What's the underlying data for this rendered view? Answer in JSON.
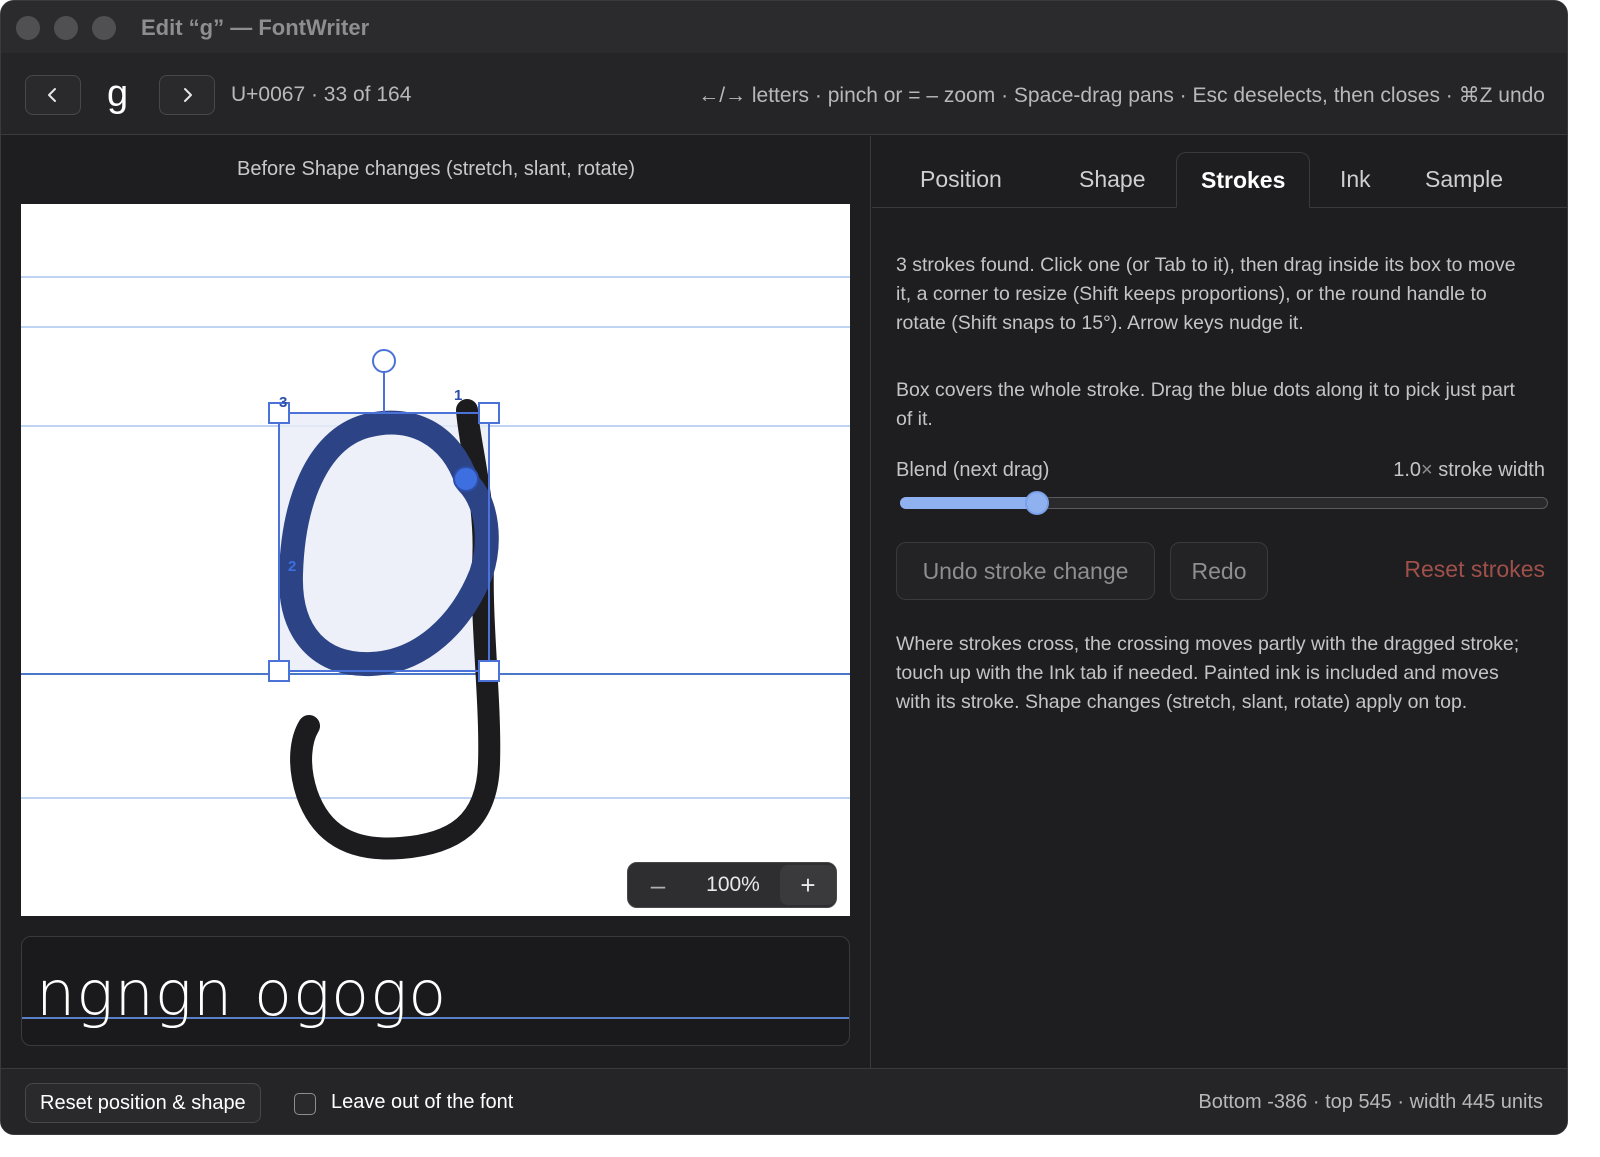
{
  "window": {
    "title": "Edit “g” — FontWriter"
  },
  "toolbar": {
    "glyph": "g",
    "glyph_info": "U+0067 · 33 of 164",
    "hints": "←/→ letters · pinch or = – zoom · Space-drag pans · Esc deselects, then closes · ⌘Z undo",
    "prev_icon": "chevron-left-icon",
    "next_icon": "chevron-right-icon"
  },
  "canvas": {
    "caption": "Before Shape changes (stretch, slant, rotate)",
    "stroke_labels": [
      "1",
      "2",
      "3"
    ],
    "selection_color": "#4a72d9",
    "stroke_color": "#1c1c1e",
    "selected_stroke_color": "#2c4385",
    "guide_color": "#8fb3e6",
    "zoom": {
      "level": "100%",
      "minus": "–",
      "plus": "+"
    }
  },
  "sample": {
    "text": "ngngn ogogo"
  },
  "tabs": [
    {
      "label": "Position",
      "active": false
    },
    {
      "label": "Shape",
      "active": false
    },
    {
      "label": "Strokes",
      "active": true
    },
    {
      "label": "Ink",
      "active": false
    },
    {
      "label": "Sample",
      "active": false
    }
  ],
  "strokes_panel": {
    "intro": "3 strokes found. Click one (or Tab to it), then drag inside its box to move it, a corner to resize (Shift keeps proportions), or the round handle to rotate (Shift snaps to 15°). Arrow keys nudge it.",
    "box_info": "Box covers the whole stroke. Drag the blue dots along it to pick just part of it.",
    "blend_label": "Blend (next drag)",
    "blend_value": "1.0",
    "blend_mult": "×",
    "blend_suffix": "stroke width",
    "blend_fraction": 0.2,
    "undo_label": "Undo stroke change",
    "redo_label": "Redo",
    "reset_label": "Reset strokes",
    "note": "Where strokes cross, the crossing moves partly with the dragged stroke; touch up with the Ink tab if needed. Painted ink is included and moves with its stroke. Shape changes (stretch, slant, rotate) apply on top."
  },
  "bottom": {
    "reset_label": "Reset position & shape",
    "leave_out_label": "Leave out of the font",
    "leave_out_checked": false,
    "metrics": "Bottom -386 · top 545 · width 445 units"
  }
}
